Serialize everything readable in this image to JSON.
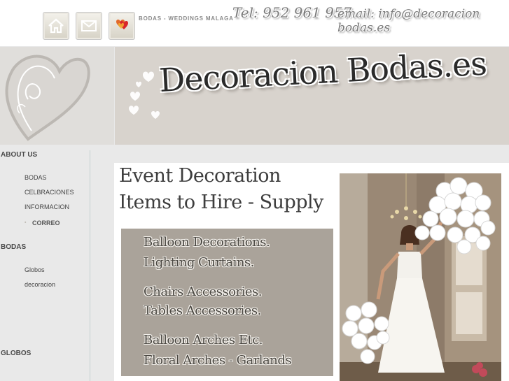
{
  "header": {
    "icons": [
      "home-icon",
      "mail-icon",
      "hearts-icon"
    ],
    "tagline": "BODAS - WEDDINGS MALAGA",
    "phone": "Tel: 952 961 957",
    "email": "email: info@decoracion bodas.es"
  },
  "banner": {
    "brand": "Decoracion Bodas.es"
  },
  "sidebar": {
    "sections": [
      {
        "title": "ABOUT US",
        "items": [
          "BODAS",
          "CELBRACIONES",
          "INFORMACION",
          "CORREO"
        ]
      },
      {
        "title": "BODAS",
        "items": [
          "Globos",
          "decoracion"
        ]
      },
      {
        "title": "GLOBOS",
        "items": []
      }
    ],
    "bullet": "▪"
  },
  "main": {
    "heading_line1": "Event Decoration",
    "heading_line2": "Items to Hire - Supply",
    "features": [
      "Balloon Decorations.",
      "Lighting Curtains.",
      "Chairs Accessories.",
      "Tables Accessories.",
      "Balloon Arches Etc.",
      "Floral Arches - Garlands"
    ]
  },
  "colors": {
    "banner_bg": "#d8d3cd",
    "feature_box": "#aaa39a",
    "text_dark": "#3d3d3d"
  }
}
